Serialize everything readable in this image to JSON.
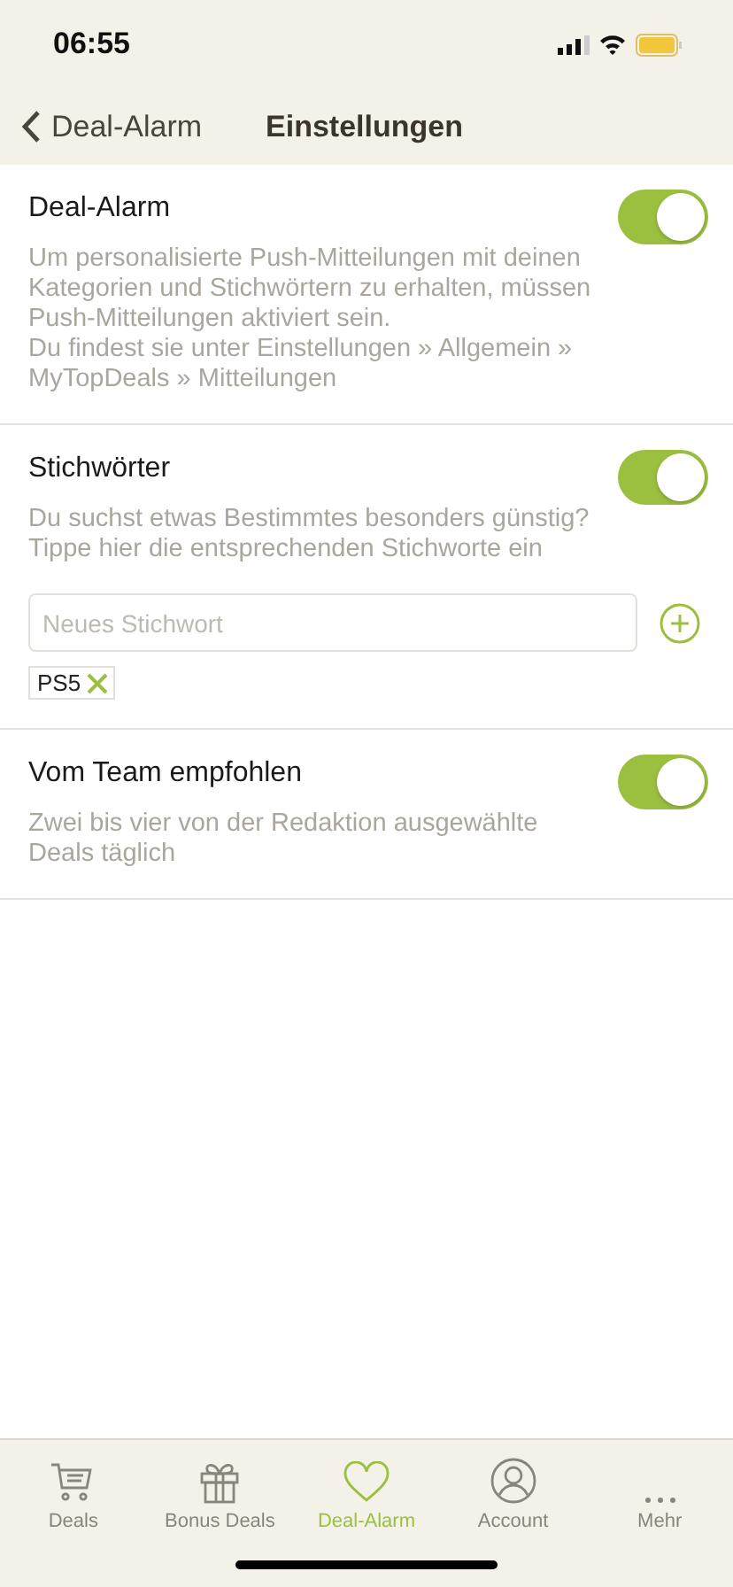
{
  "status_bar": {
    "time": "06:55"
  },
  "nav": {
    "back_label": "Deal-Alarm",
    "title": "Einstellungen"
  },
  "sections": [
    {
      "kind": "plain",
      "title": "Deal-Alarm",
      "on": true,
      "description": "Um personalisierte Push-Mitteilungen mit deinen Kategorien und Stichwörtern zu erhalten, müssen Push-Mitteilungen aktiviert sein.\nDu findest sie unter Einstellungen » Allgemein » MyTopDeals » Mitteilungen"
    },
    {
      "kind": "keywords",
      "title": "Stichwörter",
      "on": true,
      "description": "Du suchst etwas Bestimmtes besonders günstig? Tippe hier die entsprechenden Stichworte ein",
      "placeholder": "Neues Stichwort",
      "tags": [
        "PS5"
      ]
    },
    {
      "kind": "plain",
      "title": "Vom Team empfohlen",
      "on": true,
      "description": "Zwei bis vier von der Redaktion ausgewählte Deals täglich"
    }
  ],
  "tab_bar": [
    {
      "kind": "cart",
      "label": "Deals",
      "selected": false
    },
    {
      "kind": "gift",
      "label": "Bonus Deals",
      "selected": false
    },
    {
      "kind": "heart",
      "label": "Deal-Alarm",
      "selected": true
    },
    {
      "kind": "person",
      "label": "Account",
      "selected": false
    },
    {
      "kind": "dots",
      "label": "Mehr",
      "selected": false
    }
  ]
}
